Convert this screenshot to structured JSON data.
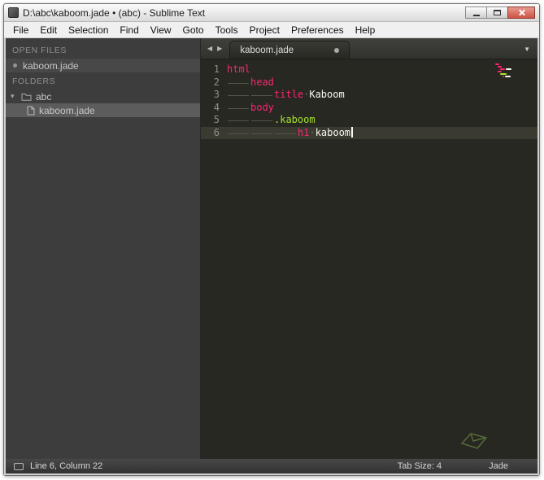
{
  "window": {
    "title": "D:\\abc\\kaboom.jade • (abc) - Sublime Text"
  },
  "menu": {
    "items": [
      "File",
      "Edit",
      "Selection",
      "Find",
      "View",
      "Goto",
      "Tools",
      "Project",
      "Preferences",
      "Help"
    ]
  },
  "sidebar": {
    "open_files_header": "OPEN FILES",
    "open_files": [
      "kaboom.jade"
    ],
    "folders_header": "FOLDERS",
    "folder_name": "abc",
    "folder_files": [
      "kaboom.jade"
    ],
    "icons": {
      "expanded": "▾"
    }
  },
  "editor": {
    "tab_label": "kaboom.jade",
    "nav": {
      "left": "◀",
      "right": "▶",
      "overflow": "▼"
    },
    "whitespace_dot": "·",
    "colors": {
      "keyword": "#f92672",
      "text": "#f8f8f2",
      "class": "#a6e22e",
      "ws": "#56544b",
      "dot": "#75715e"
    },
    "lines": [
      {
        "num": "1",
        "tokens": [
          {
            "t": "txt",
            "text": "html",
            "c": "keyword"
          }
        ]
      },
      {
        "num": "2",
        "tokens": [
          {
            "t": "tab"
          },
          {
            "t": "txt",
            "text": "head",
            "c": "keyword"
          }
        ]
      },
      {
        "num": "3",
        "tokens": [
          {
            "t": "tab"
          },
          {
            "t": "tab"
          },
          {
            "t": "txt",
            "text": "title",
            "c": "keyword"
          },
          {
            "t": "dot"
          },
          {
            "t": "txt",
            "text": "Kaboom",
            "c": "text"
          }
        ]
      },
      {
        "num": "4",
        "tokens": [
          {
            "t": "tab"
          },
          {
            "t": "txt",
            "text": "body",
            "c": "keyword"
          }
        ]
      },
      {
        "num": "5",
        "tokens": [
          {
            "t": "tab"
          },
          {
            "t": "tab"
          },
          {
            "t": "txt",
            "text": ".kaboom",
            "c": "class"
          }
        ]
      },
      {
        "num": "6",
        "current": true,
        "cursor": true,
        "tokens": [
          {
            "t": "tab"
          },
          {
            "t": "tab"
          },
          {
            "t": "tab"
          },
          {
            "t": "txt",
            "text": "h1",
            "c": "keyword"
          },
          {
            "t": "dot"
          },
          {
            "t": "txt",
            "text": "kaboom",
            "c": "text"
          }
        ]
      }
    ]
  },
  "status": {
    "position": "Line 6, Column 22",
    "tab_size": "Tab Size: 4",
    "syntax": "Jade"
  }
}
